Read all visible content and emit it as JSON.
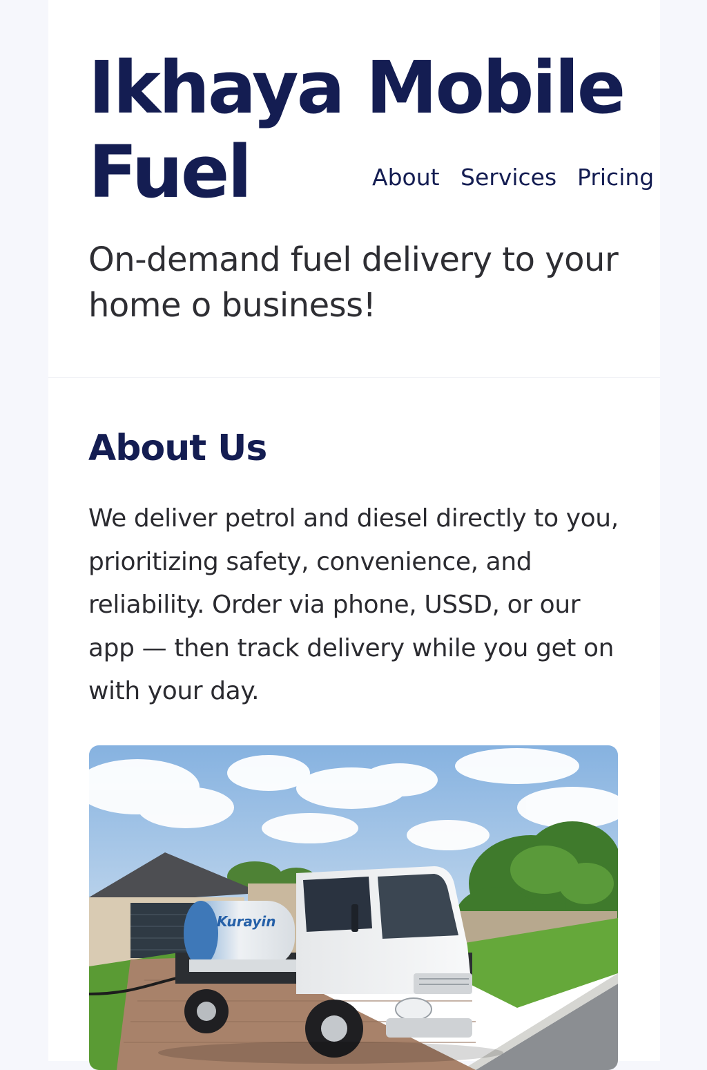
{
  "site": {
    "brand_line1": "Ikhaya Mobile",
    "brand_line2": "Fuel"
  },
  "nav": {
    "items": [
      {
        "label": "About"
      },
      {
        "label": "Services"
      },
      {
        "label": "Pricing"
      }
    ]
  },
  "hero": {
    "tagline": "On-demand fuel delivery to your home o business!"
  },
  "about": {
    "title": "About Us",
    "body": "We deliver petrol and diesel directly to you, prioritizing safety, convenience, and reliability. Order via phone, USSD, or our app — then track delivery while you get on with your day.",
    "image_tank_text": "Kurayin"
  },
  "colors": {
    "brand": "#141d52",
    "text": "#2b2b30",
    "page_background": "#f6f7fc",
    "card_background": "#ffffff"
  }
}
